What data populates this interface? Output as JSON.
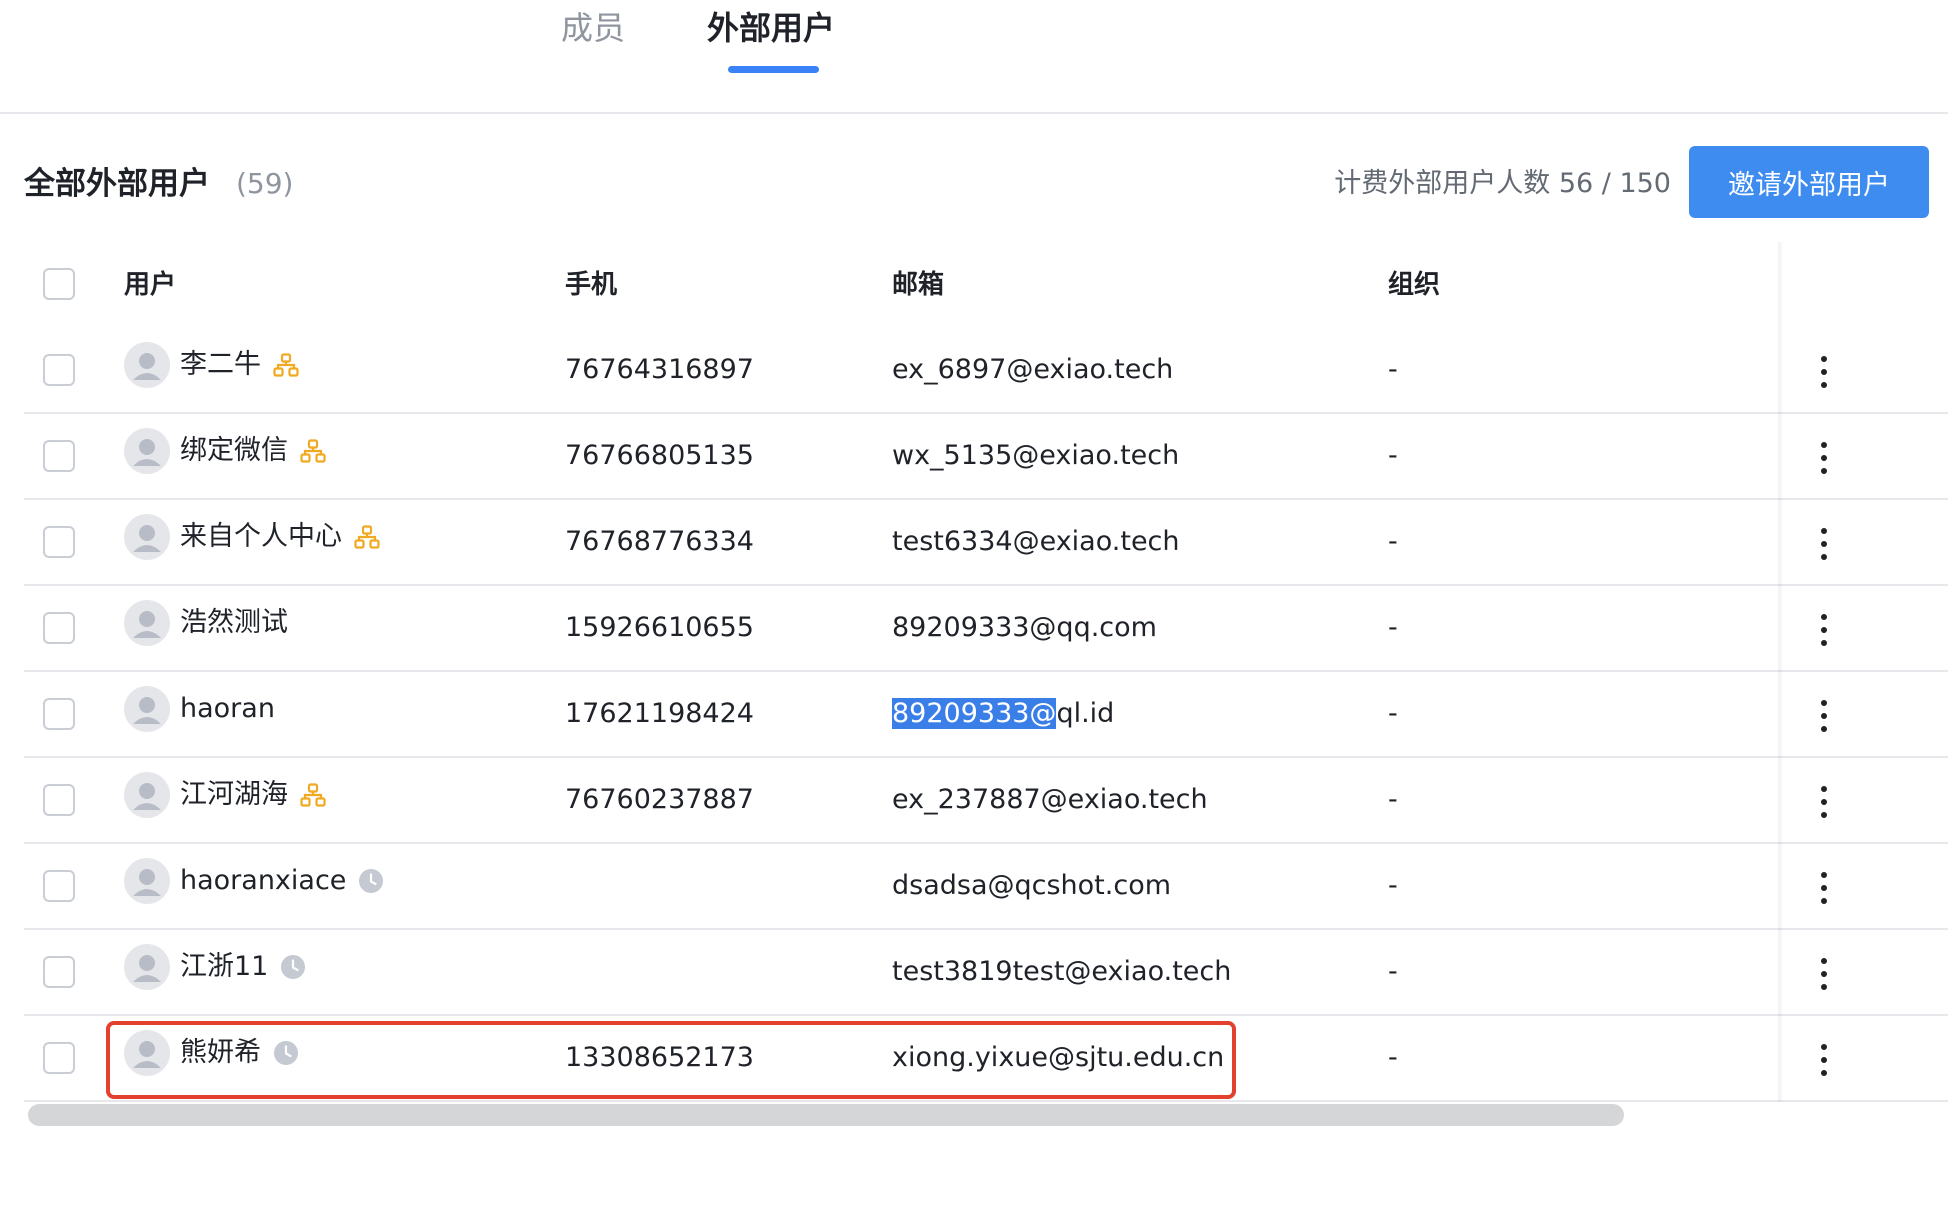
{
  "tabs": [
    {
      "label": "成员",
      "active": false
    },
    {
      "label": "外部用户",
      "active": true
    }
  ],
  "section": {
    "title": "全部外部用户",
    "count": "(59)",
    "billing": "计费外部用户人数 56 / 150",
    "invite_label": "邀请外部用户"
  },
  "columns": {
    "user": "用户",
    "phone": "手机",
    "email": "邮箱",
    "org": "组织"
  },
  "rows": [
    {
      "name": "李二牛",
      "badge": "org-icon",
      "phone": "76764316897",
      "email": "ex_6897@exiao.tech",
      "email_highlight": "",
      "org": "-"
    },
    {
      "name": "绑定微信",
      "badge": "org-icon",
      "phone": "76766805135",
      "email": "wx_5135@exiao.tech",
      "email_highlight": "",
      "org": "-"
    },
    {
      "name": "来自个人中心",
      "badge": "org-icon",
      "phone": "76768776334",
      "email": "test6334@exiao.tech",
      "email_highlight": "",
      "org": "-"
    },
    {
      "name": "浩然测试",
      "badge": "",
      "phone": "15926610655",
      "email": "89209333@qq.com",
      "email_highlight": "",
      "org": "-"
    },
    {
      "name": "haoran",
      "badge": "",
      "phone": "17621198424",
      "email": "ql.id",
      "email_highlight": "89209333@",
      "org": "-"
    },
    {
      "name": "江河湖海",
      "badge": "org-icon",
      "phone": "76760237887",
      "email": "ex_237887@exiao.tech",
      "email_highlight": "",
      "org": "-"
    },
    {
      "name": "haoranxiace",
      "badge": "clock-icon",
      "phone": "",
      "email": "dsadsa@qcshot.com",
      "email_highlight": "",
      "org": "-"
    },
    {
      "name": "江浙11",
      "badge": "clock-icon",
      "phone": "",
      "email": "test3819test@exiao.tech",
      "email_highlight": "",
      "org": "-"
    },
    {
      "name": "熊妍希",
      "badge": "clock-icon",
      "phone": "13308652173",
      "email": "xiong.yixue@sjtu.edu.cn",
      "email_highlight": "",
      "org": "-"
    }
  ],
  "colors": {
    "accent": "#3f8cf0",
    "org_badge": "#f0a920",
    "clock_badge": "#c4c9d2",
    "highlight_box": "#e2412e"
  }
}
